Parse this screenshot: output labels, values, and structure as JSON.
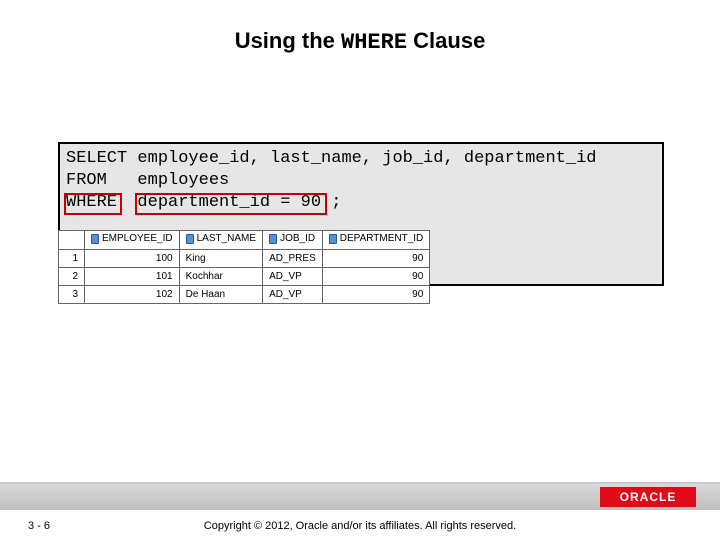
{
  "title": {
    "prefix": "Using the ",
    "keyword": "WHERE",
    "suffix": " Clause"
  },
  "code": {
    "line1": "SELECT employee_id, last_name, job_id, department_id",
    "line2": "FROM   employees",
    "line3": "WHERE  department_id = 90 ;"
  },
  "results": {
    "headers": {
      "c1": "EMPLOYEE_ID",
      "c2": "LAST_NAME",
      "c3": "JOB_ID",
      "c4": "DEPARTMENT_ID"
    },
    "rows": [
      {
        "n": "1",
        "emp": "100",
        "name": "King",
        "job": "AD_PRES",
        "dept": "90"
      },
      {
        "n": "2",
        "emp": "101",
        "name": "Kochhar",
        "job": "AD_VP",
        "dept": "90"
      },
      {
        "n": "3",
        "emp": "102",
        "name": "De Haan",
        "job": "AD_VP",
        "dept": "90"
      }
    ]
  },
  "footer": {
    "page": "3 - 6",
    "copyright": "Copyright © 2012, Oracle and/or its affiliates. All rights reserved.",
    "logo": "ORACLE"
  }
}
